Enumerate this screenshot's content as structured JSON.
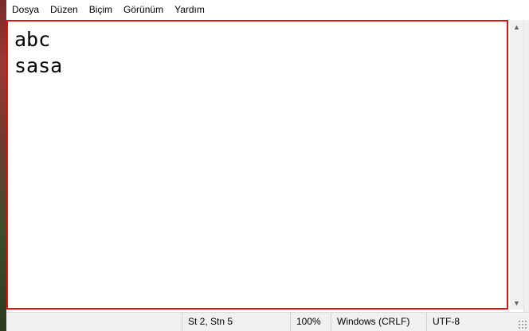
{
  "menu": {
    "items": [
      {
        "label": "Dosya"
      },
      {
        "label": "Düzen"
      },
      {
        "label": "Biçim"
      },
      {
        "label": "Görünüm"
      },
      {
        "label": "Yardım"
      }
    ]
  },
  "editor": {
    "lines": [
      "abc",
      "sasa"
    ],
    "highlight_color": "#e01010"
  },
  "status": {
    "position": "St 2, Stn 5",
    "zoom": "100%",
    "line_ending": "Windows (CRLF)",
    "encoding": "UTF-8"
  },
  "icons": {
    "scroll_up": "chevron-up-icon",
    "scroll_down": "chevron-down-icon",
    "resize": "resize-grip-icon"
  }
}
